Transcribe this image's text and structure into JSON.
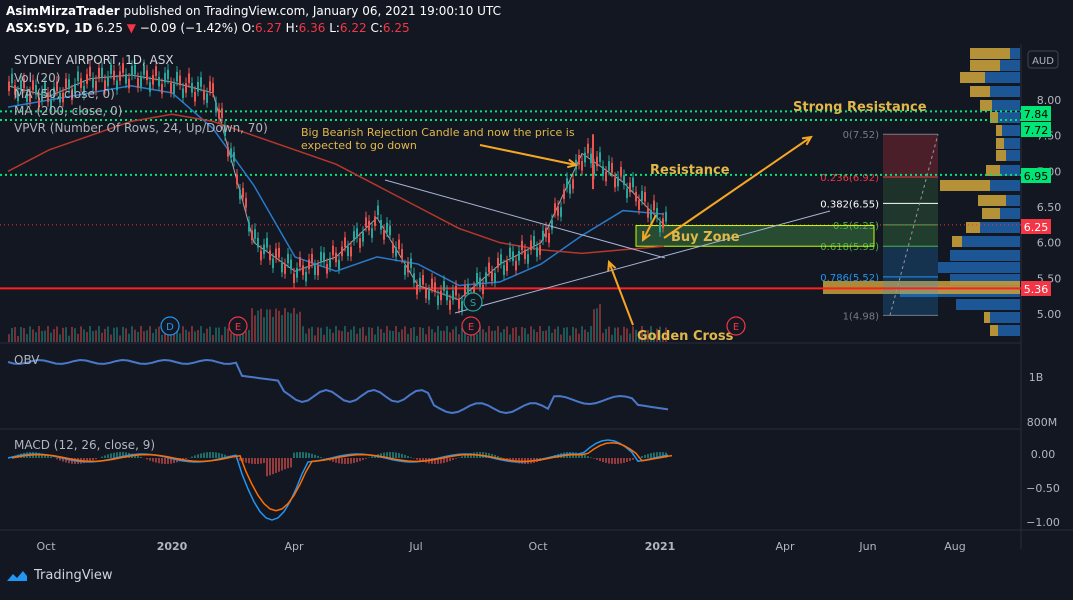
{
  "header": {
    "publisher": "AsimMirzaTrader",
    "published_text": "published on TradingView.com, January 06, 2021 19:00:10 UTC",
    "symbol_line": "ASX:SYD, 1D",
    "last": "6.25",
    "change_arrow": "▼",
    "change": "−0.09 (−1.42%)",
    "o_label": "O:",
    "o": "6.27",
    "h_label": "H:",
    "h": "6.36",
    "l_label": "L:",
    "l": "6.22",
    "c_label": "C:",
    "c": "6.25"
  },
  "legend": {
    "name": "SYDNEY AIRPORT, 1D, ASX",
    "vol": "Vol (20)",
    "ma50": "MA (50, close, 0)",
    "ma200": "MA (200, close, 0)",
    "vpvr": "VPVR (Number Of Rows, 24, Up/Down, 70)"
  },
  "currency": "AUD",
  "price_axis": [
    "8.00",
    "7.50",
    "7.00",
    "6.50",
    "6.00",
    "5.50",
    "5.00"
  ],
  "price_badges": [
    {
      "text": "7.84",
      "color": "#00e676",
      "value": 7.84
    },
    {
      "text": "7.72",
      "color": "#00e676",
      "value": 7.72
    },
    {
      "text": "6.95",
      "color": "#00e676",
      "value": 6.95
    },
    {
      "text": "6.25",
      "color": "#f23645",
      "value": 6.25
    },
    {
      "text": "5.36",
      "color": "#f23645",
      "value": 5.36
    }
  ],
  "fib_levels": [
    {
      "label": "0(7.52)",
      "value": 7.52,
      "color": "#787b86"
    },
    {
      "label": "0.236(6.92)",
      "value": 6.92,
      "color": "#f23645"
    },
    {
      "label": "0.382(6.55)",
      "value": 6.55,
      "color": "#ffffff"
    },
    {
      "label": "0.5(6.25)",
      "value": 6.25,
      "color": "#4caf50"
    },
    {
      "label": "0.618(5.95)",
      "value": 5.95,
      "color": "#4caf50"
    },
    {
      "label": "0.786(5.52)",
      "value": 5.52,
      "color": "#2196f3"
    },
    {
      "label": "1(4.98)",
      "value": 4.98,
      "color": "#787b86"
    }
  ],
  "annotations": {
    "strong_resistance": "Strong Resistance",
    "resistance": "Resistance",
    "bearish_note_line1": "Big Bearish Rejection Candle and now the price is",
    "bearish_note_line2": "expected to go down",
    "buy_zone": "Buy Zone",
    "golden_cross": "Golden Cross"
  },
  "events": [
    {
      "text": "D",
      "color": "#2196f3"
    },
    {
      "text": "E",
      "color": "#f23645"
    },
    {
      "text": "S",
      "color": "#26a69a"
    },
    {
      "text": "E",
      "color": "#f23645"
    },
    {
      "text": "E",
      "color": "#f23645"
    }
  ],
  "obv": {
    "title": "OBV",
    "axis": [
      "1B",
      "800M"
    ]
  },
  "macd": {
    "title": "MACD (12, 26, close, 9)",
    "axis": [
      "0.00",
      "−0.50",
      "−1.00"
    ]
  },
  "time_axis": [
    "Oct",
    "2020",
    "Apr",
    "Jul",
    "Oct",
    "2021",
    "Apr",
    "Jun",
    "Aug"
  ],
  "brand": "TradingView",
  "chart_data": {
    "type": "line",
    "title": "SYDNEY AIRPORT, 1D, ASX",
    "ylim": [
      4.75,
      8.25
    ],
    "x": [
      "2019-09",
      "2019-10",
      "2019-11",
      "2019-12",
      "2020-01",
      "2020-02",
      "2020-03",
      "2020-04",
      "2020-05",
      "2020-06",
      "2020-07",
      "2020-08",
      "2020-09",
      "2020-10",
      "2020-11",
      "2020-12",
      "2021-01"
    ],
    "series": [
      {
        "name": "Price",
        "values": [
          8.2,
          8.05,
          8.3,
          8.35,
          8.25,
          8.1,
          6.0,
          5.6,
          5.8,
          6.35,
          5.4,
          5.2,
          5.7,
          6.0,
          7.25,
          6.85,
          6.25
        ]
      },
      {
        "name": "MA (50, close, 0)",
        "values": [
          7.9,
          8.0,
          8.1,
          8.2,
          8.1,
          7.6,
          6.8,
          5.8,
          5.6,
          5.8,
          5.7,
          5.4,
          5.45,
          5.7,
          6.1,
          6.45,
          6.4
        ]
      },
      {
        "name": "MA (200, close, 0)",
        "values": [
          7.0,
          7.3,
          7.5,
          7.7,
          7.8,
          7.7,
          7.5,
          7.3,
          7.1,
          6.8,
          6.5,
          6.2,
          6.0,
          5.9,
          5.85,
          5.9,
          5.95
        ]
      }
    ]
  }
}
